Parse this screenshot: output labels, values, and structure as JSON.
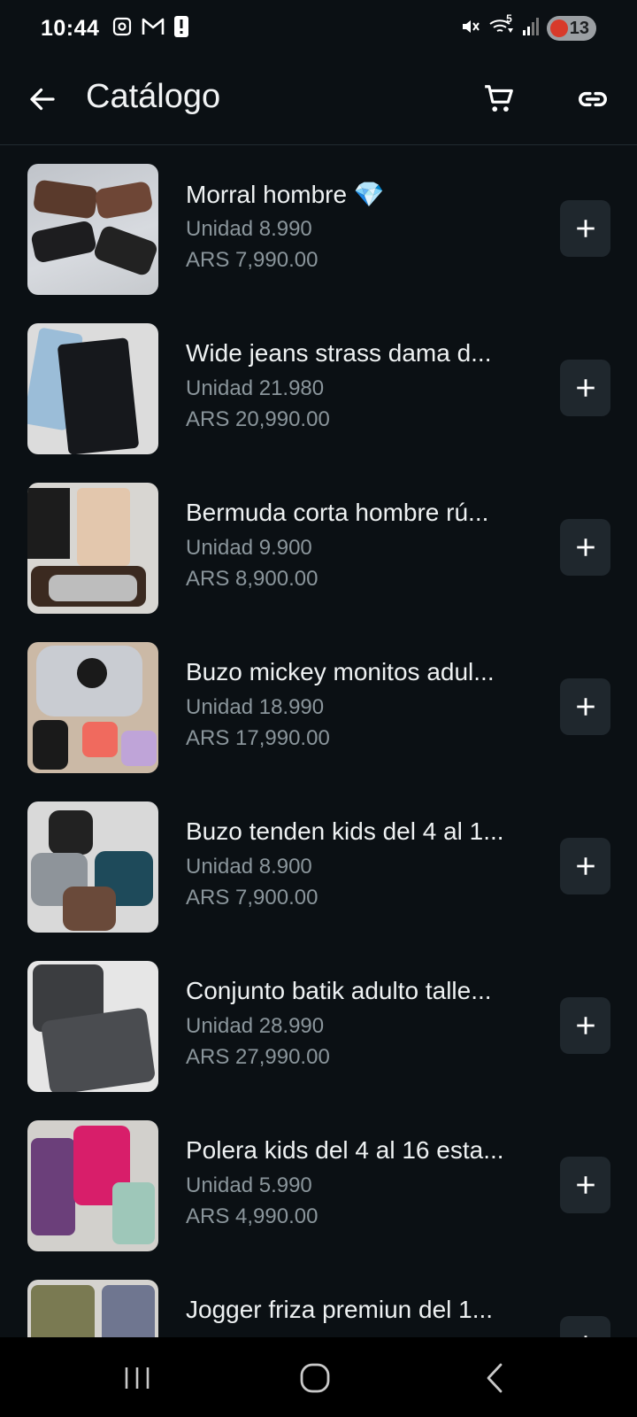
{
  "status_bar": {
    "time": "10:44",
    "left_icons": [
      "screenshot-icon",
      "gmail-icon",
      "alert-icon"
    ],
    "right_icons": [
      "mute-icon",
      "wifi-icon",
      "signal-icon"
    ],
    "wifi_label": "5",
    "battery_level": "13"
  },
  "app_bar": {
    "title": "Catálogo"
  },
  "items": [
    {
      "name": "Morral hombre 💎",
      "unit": "Unidad 8.990",
      "price": "ARS 7,990.00"
    },
    {
      "name": "Wide jeans strass dama d...",
      "unit": "Unidad 21.980",
      "price": "ARS 20,990.00"
    },
    {
      "name": "Bermuda corta hombre rú...",
      "unit": "Unidad 9.900",
      "price": "ARS 8,900.00"
    },
    {
      "name": "Buzo mickey monitos adul...",
      "unit": "Unidad 18.990",
      "price": "ARS 17,990.00"
    },
    {
      "name": "Buzo tenden kids del 4 al 1...",
      "unit": "Unidad 8.900",
      "price": "ARS 7,900.00"
    },
    {
      "name": "Conjunto batik adulto talle...",
      "unit": "Unidad 28.990",
      "price": "ARS 27,990.00"
    },
    {
      "name": "Polera kids del 4 al 16 esta...",
      "unit": "Unidad 5.990",
      "price": "ARS 4,990.00"
    },
    {
      "name": "Jogger friza premiun del 1...",
      "unit": "",
      "price": ""
    }
  ],
  "colors": {
    "background": "#0b1014",
    "add_button": "#1f272d",
    "secondary_text": "#8a959b",
    "battery_low": "#d83a2a"
  },
  "nav_bar": {
    "buttons": [
      "recents-icon",
      "home-icon",
      "back-nav-icon"
    ]
  }
}
